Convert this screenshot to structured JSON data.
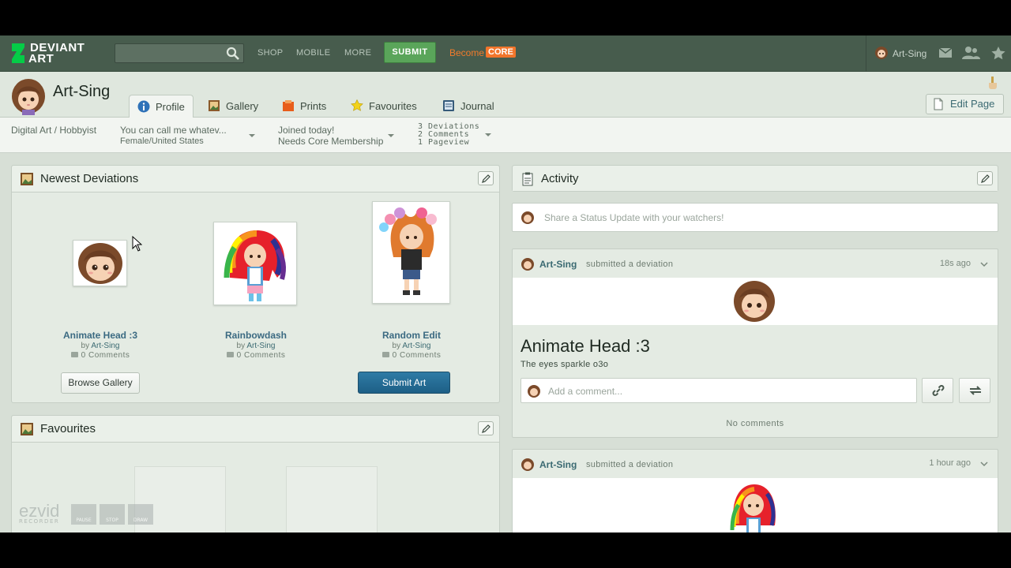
{
  "nav": {
    "logo_line1": "DEVIANT",
    "logo_line2": "ART",
    "search_placeholder": "",
    "links": [
      "SHOP",
      "MOBILE",
      "MORE"
    ],
    "submit_label": "SUBMIT",
    "become_label": "Become",
    "core_label": "CORE",
    "username": "Art-Sing",
    "icons": [
      "mail-icon",
      "watchers-icon",
      "favourites-star-icon"
    ]
  },
  "profile": {
    "name": "Art-Sing",
    "tabs": [
      {
        "label": "Profile",
        "icon": "info-icon",
        "active": true
      },
      {
        "label": "Gallery",
        "icon": "gallery-icon",
        "active": false
      },
      {
        "label": "Prints",
        "icon": "prints-icon",
        "active": false
      },
      {
        "label": "Favourites",
        "icon": "star-icon",
        "active": false
      },
      {
        "label": "Journal",
        "icon": "journal-icon",
        "active": false
      }
    ],
    "edit_page_label": "Edit Page"
  },
  "infobar": {
    "category": "Digital Art / Hobbyist",
    "tagline": "You can call me whatev...",
    "location": "Female/United States",
    "joined": "Joined today!",
    "membership": "Needs Core Membership",
    "stat1": "3 Deviations",
    "stat2": "2 Comments",
    "stat3": "1 Pageview"
  },
  "newest": {
    "title": "Newest Deviations",
    "items": [
      {
        "title": "Animate Head :3",
        "by": "by",
        "author": "Art-Sing",
        "comments": "0 Comments"
      },
      {
        "title": "Rainbowdash",
        "by": "by",
        "author": "Art-Sing",
        "comments": "0 Comments"
      },
      {
        "title": "Random Edit",
        "by": "by",
        "author": "Art-Sing",
        "comments": "0 Comments"
      }
    ],
    "browse_label": "Browse Gallery",
    "submit_label": "Submit Art"
  },
  "favourites": {
    "title": "Favourites"
  },
  "activity": {
    "title": "Activity",
    "status_placeholder": "Share a Status Update with your watchers!",
    "entries": [
      {
        "user": "Art-Sing",
        "action": "submitted a deviation",
        "time": "18s ago",
        "title": "Animate Head :3",
        "desc": "The eyes sparkle o3o",
        "comment_placeholder": "Add a comment...",
        "no_comments": "No comments"
      },
      {
        "user": "Art-Sing",
        "action": "submitted a deviation",
        "time": "1 hour ago"
      }
    ]
  },
  "watermark": {
    "brand": "ezvid",
    "sub": "RECORDER",
    "controls": [
      "PAUSE",
      "STOP",
      "DRAW"
    ]
  },
  "colors": {
    "nav_bg": "#475c4d",
    "logo_green": "#05cc47",
    "submit_green": "#5aa55a",
    "core_orange": "#f2752b",
    "link_blue": "#3b6a82",
    "page_bg": "#d7dfd6"
  }
}
